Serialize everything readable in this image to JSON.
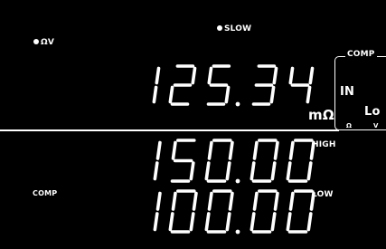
{
  "indicators": {
    "slow": "SLOW",
    "mode": "ΩV",
    "comp_left": "COMP"
  },
  "readings": {
    "main": "125.34",
    "main_unit": "mΩ",
    "high_label": "HIGH",
    "high": "150.00",
    "low_label": "LOW",
    "low": "100.00"
  },
  "comp_panel": {
    "title": "COMP",
    "status": "IN",
    "state": "Lo",
    "ohm": "Ω",
    "volt": "V"
  },
  "colors": {
    "background": "#000000",
    "foreground": "#ffffff"
  }
}
